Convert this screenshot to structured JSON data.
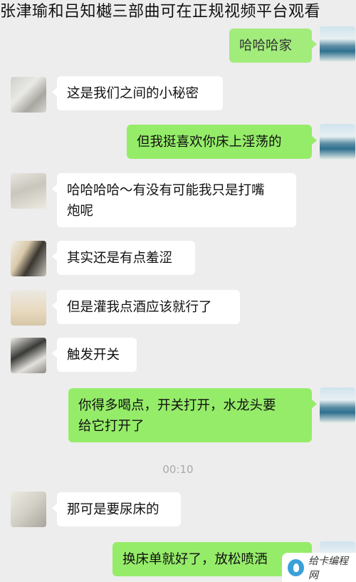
{
  "title": "张津瑜和吕知樾三部曲可在正规视频平台观看",
  "top_bubble": "哈哈哈家",
  "messages": [
    {
      "side": "left",
      "text": "这是我们之间的小秘密"
    },
    {
      "side": "right",
      "text": "但我挺喜欢你床上淫荡的"
    },
    {
      "side": "left",
      "line1": "哈哈哈哈～有没有可能我只是打嘴",
      "line2": "炮呢"
    },
    {
      "side": "left",
      "text": "其实还是有点羞涩"
    },
    {
      "side": "left",
      "text": "但是灌我点酒应该就行了"
    },
    {
      "side": "left",
      "text": "触发开关"
    },
    {
      "side": "right",
      "line1": "你得多喝点，开关打开，水龙头要",
      "line2": "给它打开了"
    },
    {
      "side": "left",
      "text": "那可是要尿床的"
    },
    {
      "side": "right",
      "text": "换床单就好了，放松喷洒"
    }
  ],
  "timestamp": "00:10",
  "watermark": "给卡编程网"
}
